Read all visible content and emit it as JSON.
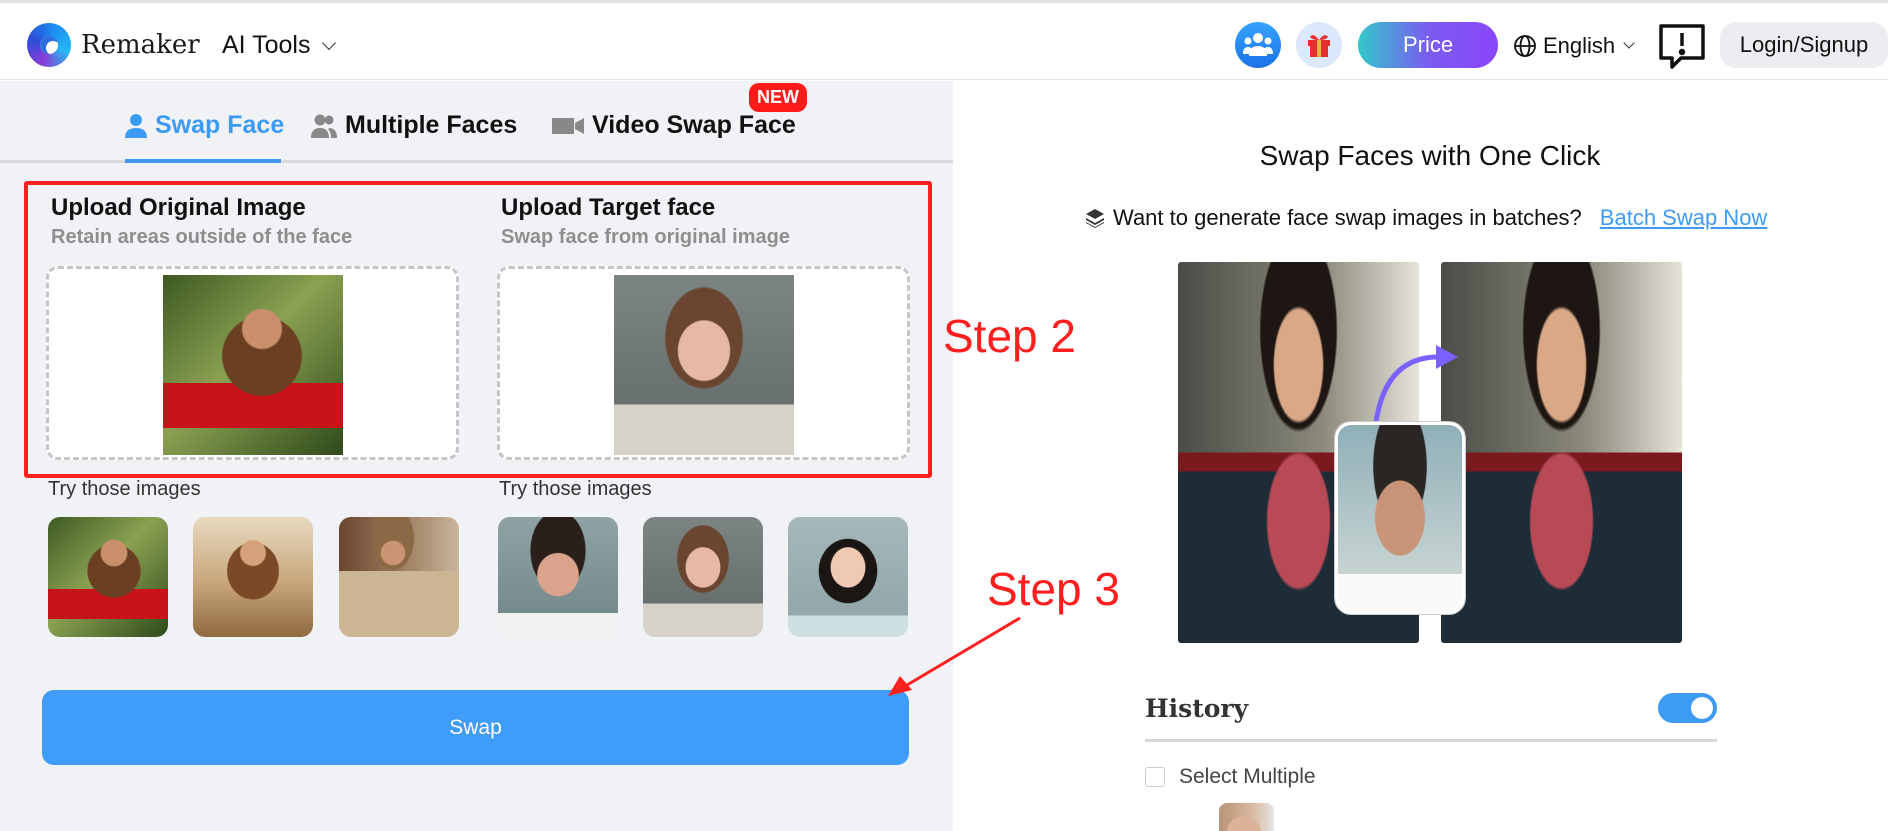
{
  "header": {
    "brand": "Remaker",
    "ai_tools_label": "AI Tools",
    "price_label": "Price",
    "language": "English",
    "login_label": "Login/Signup",
    "icons": [
      "community-icon",
      "gift-icon",
      "globe-icon",
      "feedback-icon"
    ]
  },
  "tabs": [
    {
      "label": "Swap Face",
      "icon": "user-icon",
      "active": true
    },
    {
      "label": "Multiple Faces",
      "icon": "users-icon",
      "active": false
    },
    {
      "label": "Video Swap Face",
      "icon": "video-camera-icon",
      "active": false,
      "badge": "NEW"
    }
  ],
  "upload": {
    "original": {
      "title": "Upload Original Image",
      "subtitle": "Retain areas outside of the face"
    },
    "target": {
      "title": "Upload Target face",
      "subtitle": "Swap face from original image"
    }
  },
  "samples": {
    "label": "Try those images",
    "original": [
      "woman-in-jungle",
      "woman-at-beach",
      "cowboy"
    ],
    "target": [
      "man-curly-hair",
      "woman-in-sweater",
      "asian-woman"
    ]
  },
  "swap_button": "Swap",
  "annotations": {
    "step2": "Step 2",
    "step3": "Step 3",
    "color": "#ff1f1f"
  },
  "right": {
    "title": "Swap Faces with One Click",
    "batch_prompt": "Want to generate face swap images in batches?",
    "batch_link": "Batch Swap Now",
    "history_title": "History",
    "history_toggle_on": true,
    "select_multiple": "Select Multiple"
  },
  "colors": {
    "accent": "#3d9af5",
    "panel_bg": "#f1f2f6",
    "swap_button": "#409cf9"
  }
}
